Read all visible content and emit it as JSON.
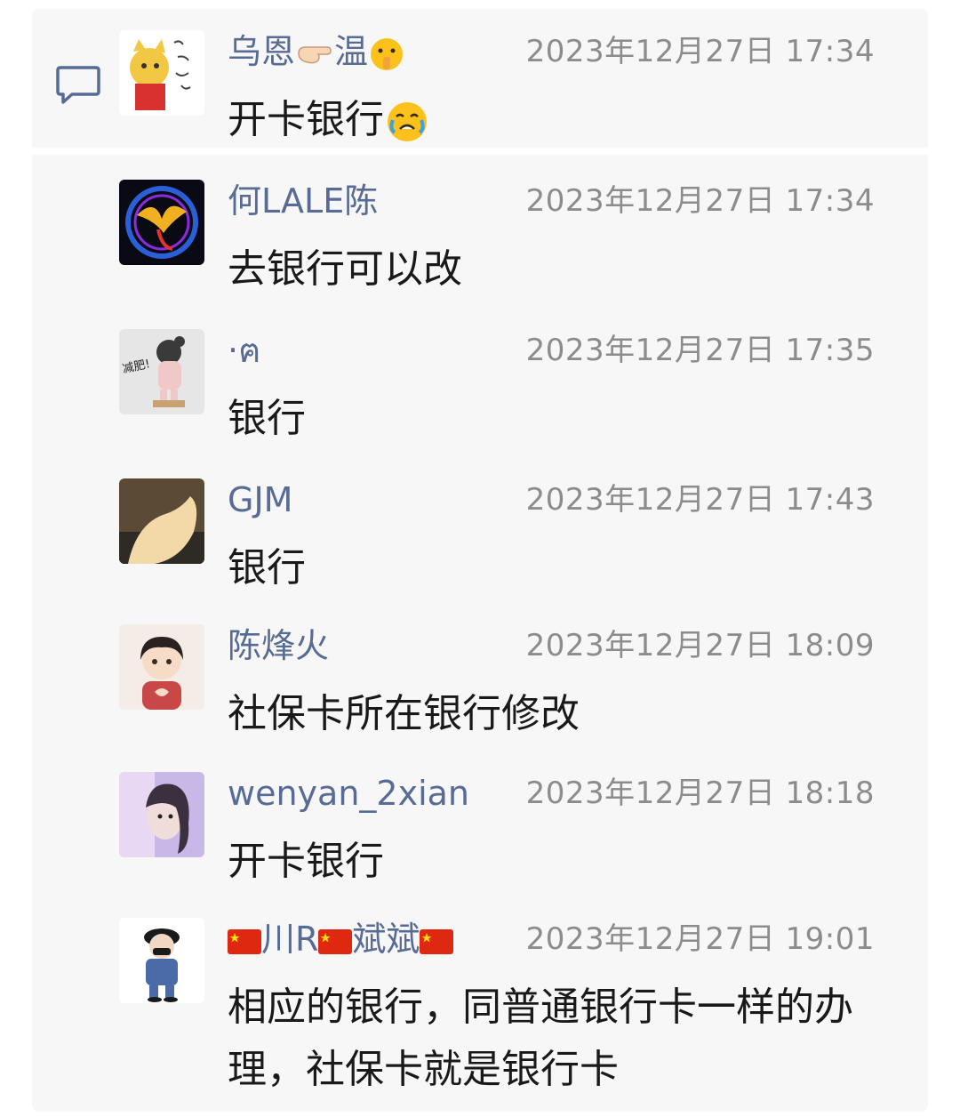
{
  "messages": [
    {
      "name": "乌恩",
      "name_suffix": "温",
      "time": "2023年12月27日 17:34",
      "text": "开卡银行",
      "avatar": "yellow-cat-avatar"
    },
    {
      "name": "何LALE陈",
      "time": "2023年12月27日 17:34",
      "text": "去银行可以改",
      "avatar": "phoenix-avatar"
    },
    {
      "name": "·ฅ",
      "time": "2023年12月27日 17:35",
      "text": "银行",
      "avatar": "cartoon-child-avatar"
    },
    {
      "name": "GJM",
      "time": "2023年12月27日 17:43",
      "text": "银行",
      "avatar": "photo-avatar"
    },
    {
      "name": "陈烽火",
      "time": "2023年12月27日 18:09",
      "text": "社保卡所在银行修改",
      "avatar": "anime-boy-avatar"
    },
    {
      "name": "wenyan_2xian",
      "time": "2023年12月27日 18:18",
      "text": "开卡银行",
      "avatar": "portrait-avatar"
    },
    {
      "name_a": "川R",
      "name_b": "斌斌",
      "time": "2023年12月27日 19:01",
      "text": "相应的银行，同普通银行卡一样的办理，社保卡就是银行卡",
      "avatar": "cartoon-figure-avatar"
    }
  ],
  "colors": {
    "name": "#576b95",
    "time": "#8c8c8c",
    "text": "#191919",
    "panel": "#f7f7f7"
  }
}
